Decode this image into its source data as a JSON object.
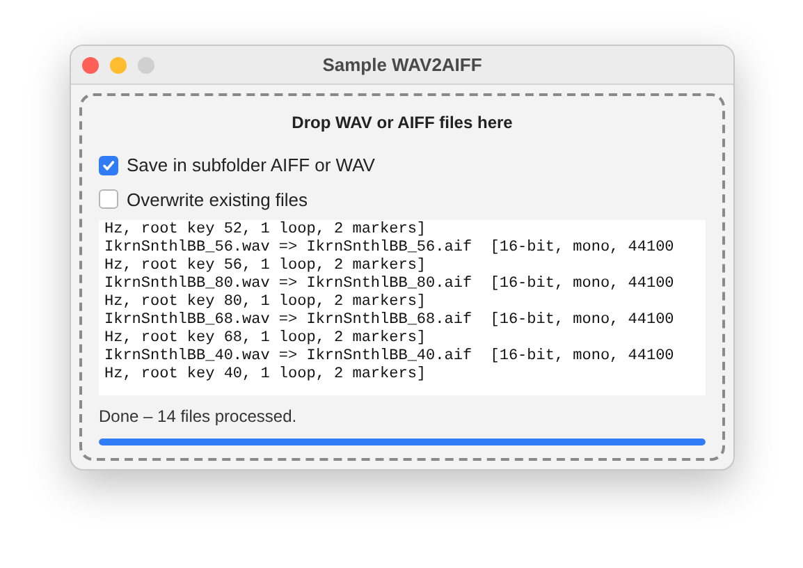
{
  "window": {
    "title": "Sample WAV2AIFF"
  },
  "drop_zone": {
    "label": "Drop WAV or AIFF files here"
  },
  "options": [
    {
      "label": "Save in subfolder AIFF or WAV",
      "checked": true
    },
    {
      "label": "Overwrite existing files",
      "checked": false
    }
  ],
  "log": [
    "Hz, root key 52, 1 loop, 2 markers]",
    "IkrnSnthlBB_56.wav => IkrnSnthlBB_56.aif  [16-bit, mono, 44100",
    "Hz, root key 56, 1 loop, 2 markers]",
    "IkrnSnthlBB_80.wav => IkrnSnthlBB_80.aif  [16-bit, mono, 44100",
    "Hz, root key 80, 1 loop, 2 markers]",
    "IkrnSnthlBB_68.wav => IkrnSnthlBB_68.aif  [16-bit, mono, 44100",
    "Hz, root key 68, 1 loop, 2 markers]",
    "IkrnSnthlBB_40.wav => IkrnSnthlBB_40.aif  [16-bit, mono, 44100",
    "Hz, root key 40, 1 loop, 2 markers]"
  ],
  "status": "Done – 14 files processed.",
  "progress": {
    "level": 1
  }
}
